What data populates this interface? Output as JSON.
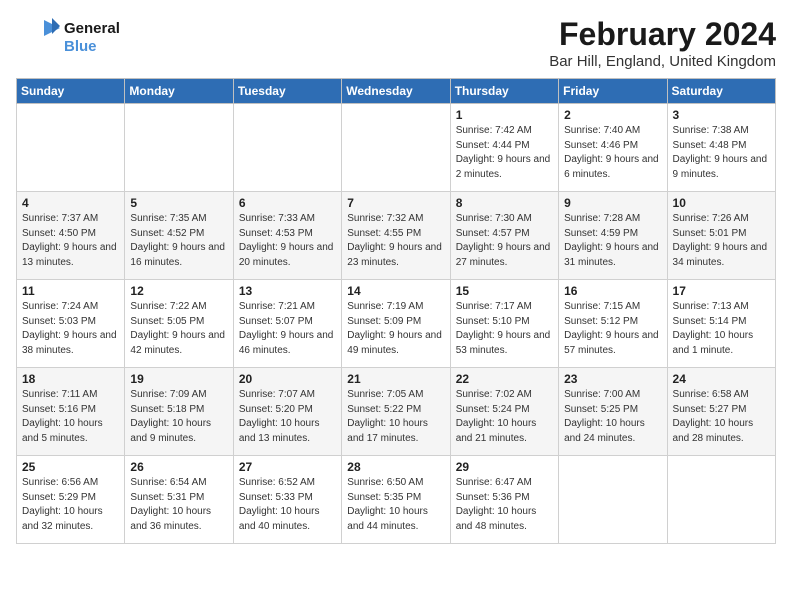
{
  "logo": {
    "line1": "General",
    "line2": "Blue"
  },
  "title": "February 2024",
  "location": "Bar Hill, England, United Kingdom",
  "days_of_week": [
    "Sunday",
    "Monday",
    "Tuesday",
    "Wednesday",
    "Thursday",
    "Friday",
    "Saturday"
  ],
  "weeks": [
    [
      {
        "day": "",
        "sunrise": "",
        "sunset": "",
        "daylight": ""
      },
      {
        "day": "",
        "sunrise": "",
        "sunset": "",
        "daylight": ""
      },
      {
        "day": "",
        "sunrise": "",
        "sunset": "",
        "daylight": ""
      },
      {
        "day": "",
        "sunrise": "",
        "sunset": "",
        "daylight": ""
      },
      {
        "day": "1",
        "sunrise": "Sunrise: 7:42 AM",
        "sunset": "Sunset: 4:44 PM",
        "daylight": "Daylight: 9 hours and 2 minutes."
      },
      {
        "day": "2",
        "sunrise": "Sunrise: 7:40 AM",
        "sunset": "Sunset: 4:46 PM",
        "daylight": "Daylight: 9 hours and 6 minutes."
      },
      {
        "day": "3",
        "sunrise": "Sunrise: 7:38 AM",
        "sunset": "Sunset: 4:48 PM",
        "daylight": "Daylight: 9 hours and 9 minutes."
      }
    ],
    [
      {
        "day": "4",
        "sunrise": "Sunrise: 7:37 AM",
        "sunset": "Sunset: 4:50 PM",
        "daylight": "Daylight: 9 hours and 13 minutes."
      },
      {
        "day": "5",
        "sunrise": "Sunrise: 7:35 AM",
        "sunset": "Sunset: 4:52 PM",
        "daylight": "Daylight: 9 hours and 16 minutes."
      },
      {
        "day": "6",
        "sunrise": "Sunrise: 7:33 AM",
        "sunset": "Sunset: 4:53 PM",
        "daylight": "Daylight: 9 hours and 20 minutes."
      },
      {
        "day": "7",
        "sunrise": "Sunrise: 7:32 AM",
        "sunset": "Sunset: 4:55 PM",
        "daylight": "Daylight: 9 hours and 23 minutes."
      },
      {
        "day": "8",
        "sunrise": "Sunrise: 7:30 AM",
        "sunset": "Sunset: 4:57 PM",
        "daylight": "Daylight: 9 hours and 27 minutes."
      },
      {
        "day": "9",
        "sunrise": "Sunrise: 7:28 AM",
        "sunset": "Sunset: 4:59 PM",
        "daylight": "Daylight: 9 hours and 31 minutes."
      },
      {
        "day": "10",
        "sunrise": "Sunrise: 7:26 AM",
        "sunset": "Sunset: 5:01 PM",
        "daylight": "Daylight: 9 hours and 34 minutes."
      }
    ],
    [
      {
        "day": "11",
        "sunrise": "Sunrise: 7:24 AM",
        "sunset": "Sunset: 5:03 PM",
        "daylight": "Daylight: 9 hours and 38 minutes."
      },
      {
        "day": "12",
        "sunrise": "Sunrise: 7:22 AM",
        "sunset": "Sunset: 5:05 PM",
        "daylight": "Daylight: 9 hours and 42 minutes."
      },
      {
        "day": "13",
        "sunrise": "Sunrise: 7:21 AM",
        "sunset": "Sunset: 5:07 PM",
        "daylight": "Daylight: 9 hours and 46 minutes."
      },
      {
        "day": "14",
        "sunrise": "Sunrise: 7:19 AM",
        "sunset": "Sunset: 5:09 PM",
        "daylight": "Daylight: 9 hours and 49 minutes."
      },
      {
        "day": "15",
        "sunrise": "Sunrise: 7:17 AM",
        "sunset": "Sunset: 5:10 PM",
        "daylight": "Daylight: 9 hours and 53 minutes."
      },
      {
        "day": "16",
        "sunrise": "Sunrise: 7:15 AM",
        "sunset": "Sunset: 5:12 PM",
        "daylight": "Daylight: 9 hours and 57 minutes."
      },
      {
        "day": "17",
        "sunrise": "Sunrise: 7:13 AM",
        "sunset": "Sunset: 5:14 PM",
        "daylight": "Daylight: 10 hours and 1 minute."
      }
    ],
    [
      {
        "day": "18",
        "sunrise": "Sunrise: 7:11 AM",
        "sunset": "Sunset: 5:16 PM",
        "daylight": "Daylight: 10 hours and 5 minutes."
      },
      {
        "day": "19",
        "sunrise": "Sunrise: 7:09 AM",
        "sunset": "Sunset: 5:18 PM",
        "daylight": "Daylight: 10 hours and 9 minutes."
      },
      {
        "day": "20",
        "sunrise": "Sunrise: 7:07 AM",
        "sunset": "Sunset: 5:20 PM",
        "daylight": "Daylight: 10 hours and 13 minutes."
      },
      {
        "day": "21",
        "sunrise": "Sunrise: 7:05 AM",
        "sunset": "Sunset: 5:22 PM",
        "daylight": "Daylight: 10 hours and 17 minutes."
      },
      {
        "day": "22",
        "sunrise": "Sunrise: 7:02 AM",
        "sunset": "Sunset: 5:24 PM",
        "daylight": "Daylight: 10 hours and 21 minutes."
      },
      {
        "day": "23",
        "sunrise": "Sunrise: 7:00 AM",
        "sunset": "Sunset: 5:25 PM",
        "daylight": "Daylight: 10 hours and 24 minutes."
      },
      {
        "day": "24",
        "sunrise": "Sunrise: 6:58 AM",
        "sunset": "Sunset: 5:27 PM",
        "daylight": "Daylight: 10 hours and 28 minutes."
      }
    ],
    [
      {
        "day": "25",
        "sunrise": "Sunrise: 6:56 AM",
        "sunset": "Sunset: 5:29 PM",
        "daylight": "Daylight: 10 hours and 32 minutes."
      },
      {
        "day": "26",
        "sunrise": "Sunrise: 6:54 AM",
        "sunset": "Sunset: 5:31 PM",
        "daylight": "Daylight: 10 hours and 36 minutes."
      },
      {
        "day": "27",
        "sunrise": "Sunrise: 6:52 AM",
        "sunset": "Sunset: 5:33 PM",
        "daylight": "Daylight: 10 hours and 40 minutes."
      },
      {
        "day": "28",
        "sunrise": "Sunrise: 6:50 AM",
        "sunset": "Sunset: 5:35 PM",
        "daylight": "Daylight: 10 hours and 44 minutes."
      },
      {
        "day": "29",
        "sunrise": "Sunrise: 6:47 AM",
        "sunset": "Sunset: 5:36 PM",
        "daylight": "Daylight: 10 hours and 48 minutes."
      },
      {
        "day": "",
        "sunrise": "",
        "sunset": "",
        "daylight": ""
      },
      {
        "day": "",
        "sunrise": "",
        "sunset": "",
        "daylight": ""
      }
    ]
  ]
}
